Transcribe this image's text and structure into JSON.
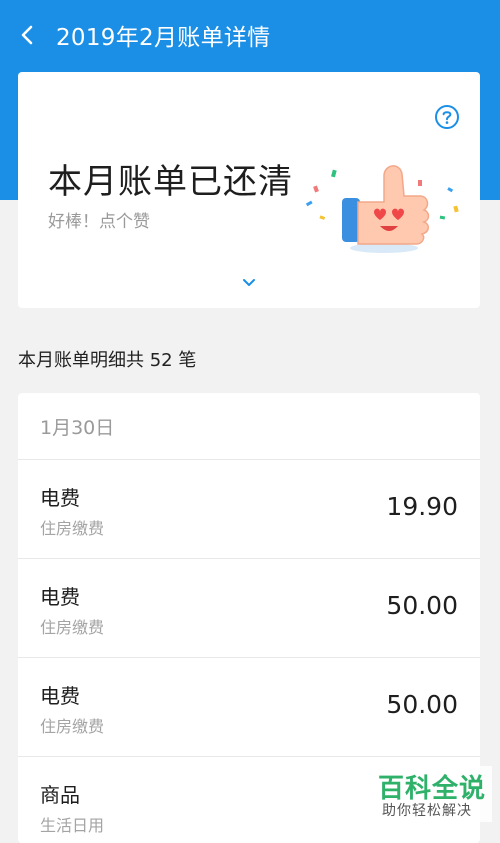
{
  "header": {
    "title": "2019年2月账单详情",
    "back_icon": "chevron-left-icon",
    "background_color": "#1b8fe6"
  },
  "summary": {
    "status_title": "本月账单已还清",
    "status_subtitle": "好棒！点个赞",
    "help_icon": "question-circle-icon",
    "expand_icon": "chevron-down-icon"
  },
  "bill_count_text": "本月账单明细共 52 笔",
  "list": {
    "date": "1月30日",
    "rows": [
      {
        "name": "电费",
        "category": "住房缴费",
        "amount": "19.90"
      },
      {
        "name": "电费",
        "category": "住房缴费",
        "amount": "50.00"
      },
      {
        "name": "电费",
        "category": "住房缴费",
        "amount": "50.00"
      },
      {
        "name": "商品",
        "category": "生活日用",
        "amount": ""
      }
    ]
  },
  "watermark": {
    "title": "百科全说",
    "subtitle": "助你轻松解决"
  }
}
